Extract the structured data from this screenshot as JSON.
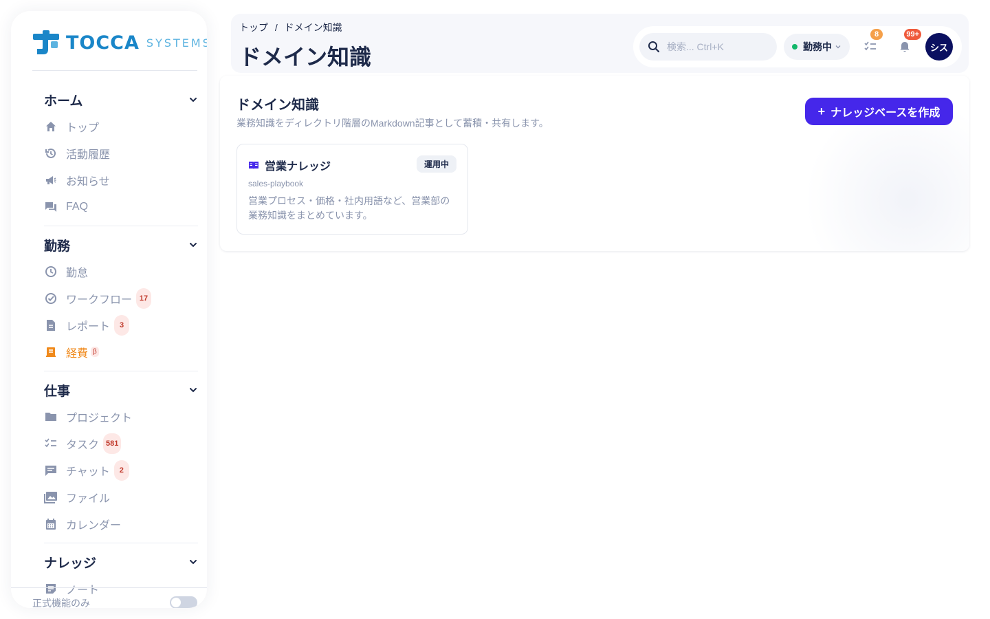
{
  "logo": {
    "brand": "TOCCA",
    "suffix": "SYSTEMS"
  },
  "sidebar": {
    "sections": [
      {
        "title": "ホーム",
        "items": [
          {
            "label": "トップ",
            "icon": "home-icon"
          },
          {
            "label": "活動履歴",
            "icon": "history-icon"
          },
          {
            "label": "お知らせ",
            "icon": "megaphone-icon"
          },
          {
            "label": "FAQ",
            "icon": "faq-icon"
          }
        ]
      },
      {
        "title": "勤務",
        "items": [
          {
            "label": "勤怠",
            "icon": "clock-icon"
          },
          {
            "label": "ワークフロー",
            "icon": "check-circle-icon",
            "badge": "17"
          },
          {
            "label": "レポート",
            "icon": "document-icon",
            "badge": "3"
          },
          {
            "label": "経費",
            "icon": "receipt-icon",
            "beta": "β",
            "active": true
          }
        ]
      },
      {
        "title": "仕事",
        "items": [
          {
            "label": "プロジェクト",
            "icon": "folder-icon"
          },
          {
            "label": "タスク",
            "icon": "checklist-icon",
            "badge": "581"
          },
          {
            "label": "チャット",
            "icon": "chat-icon",
            "badge": "2"
          },
          {
            "label": "ファイル",
            "icon": "images-icon"
          },
          {
            "label": "カレンダー",
            "icon": "calendar-icon"
          }
        ]
      },
      {
        "title": "ナレッジ",
        "items": [
          {
            "label": "ノート",
            "icon": "note-icon"
          }
        ]
      }
    ],
    "footer_label": "正式機能のみ",
    "toggle_on": false
  },
  "header": {
    "breadcrumb": [
      "トップ",
      "/",
      "ドメイン知識"
    ],
    "title": "ドメイン知識",
    "search_placeholder": "検索... Ctrl+K",
    "status_label": "勤務中",
    "status_color": "#12b76a",
    "tasks_count": "8",
    "notifications_count": "99+",
    "avatar_label": "シス"
  },
  "main": {
    "title": "ドメイン知識",
    "subtitle": "業務知識をディレクトリ階層のMarkdown記事として蓄積・共有します。",
    "create_button": "ナレッジベースを作成",
    "accent_color": "#4527ea",
    "knowledge_bases": [
      {
        "name": "営業ナレッジ",
        "status": "運用中",
        "slug": "sales-playbook",
        "description": "営業プロセス・価格・社内用語など、営業部の業務知識をまとめています。",
        "icon": "book-icon"
      }
    ]
  }
}
